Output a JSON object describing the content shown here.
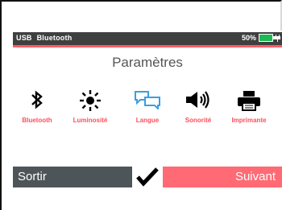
{
  "status": {
    "usb_label": "USB",
    "bluetooth_label": "Bluetooth",
    "battery_percent": "50%",
    "battery_color": "#1db954"
  },
  "header": {
    "title": "Paramètres"
  },
  "menu": {
    "items": [
      {
        "label": "Bluetooth",
        "icon": "bluetooth-icon"
      },
      {
        "label": "Luminosité",
        "icon": "brightness-icon"
      },
      {
        "label": "Langue",
        "icon": "language-chat-icon"
      },
      {
        "label": "Sonorité",
        "icon": "speaker-icon"
      },
      {
        "label": "Imprimante",
        "icon": "printer-icon"
      }
    ]
  },
  "nav": {
    "exit_label": "Sortir",
    "next_label": "Suivant"
  },
  "colors": {
    "accent": "#ff5a64",
    "label": "#ff4d5a",
    "dark": "#4d5559",
    "language_icon": "#3b9fe0"
  }
}
